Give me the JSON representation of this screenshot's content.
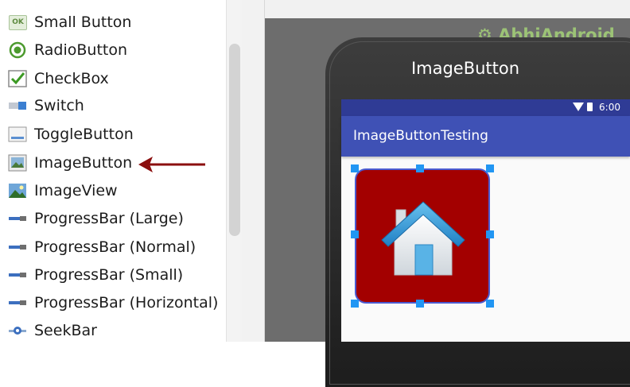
{
  "palette": {
    "items": [
      {
        "label": "Small Button",
        "icon": "ok-button-icon"
      },
      {
        "label": "RadioButton",
        "icon": "radio-button-icon"
      },
      {
        "label": "CheckBox",
        "icon": "checkbox-icon"
      },
      {
        "label": "Switch",
        "icon": "switch-icon"
      },
      {
        "label": "ToggleButton",
        "icon": "toggle-button-icon"
      },
      {
        "label": "ImageButton",
        "icon": "image-button-icon"
      },
      {
        "label": "ImageView",
        "icon": "image-view-icon"
      },
      {
        "label": "ProgressBar (Large)",
        "icon": "progressbar-icon"
      },
      {
        "label": "ProgressBar (Normal)",
        "icon": "progressbar-icon"
      },
      {
        "label": "ProgressBar (Small)",
        "icon": "progressbar-icon"
      },
      {
        "label": "ProgressBar (Horizontal)",
        "icon": "progressbar-icon"
      },
      {
        "label": "SeekBar",
        "icon": "seekbar-icon"
      }
    ],
    "ok_icon_text": "OK"
  },
  "annotation": {
    "pointer": "red-arrow-icon",
    "color": "#8b0f0f"
  },
  "device": {
    "title": "ImageButton",
    "status_time": "6:00",
    "app_title": "ImageButtonTesting",
    "watermark": "AbhiAndroid"
  },
  "colors": {
    "status_bar": "#2f3b95",
    "app_bar": "#3f51b5",
    "image_button_bg": "#a30000",
    "selection_handle": "#2196f3"
  }
}
